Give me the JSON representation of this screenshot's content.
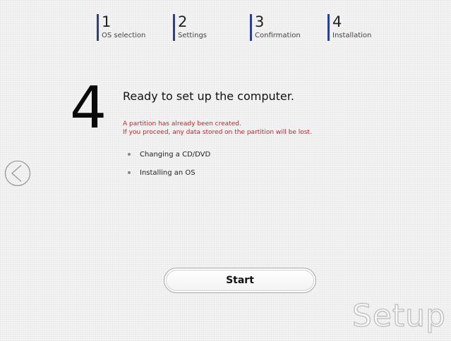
{
  "steps": [
    {
      "number": "1",
      "label": "OS selection"
    },
    {
      "number": "2",
      "label": "Settings"
    },
    {
      "number": "3",
      "label": "Confirmation"
    },
    {
      "number": "4",
      "label": "Installation"
    }
  ],
  "current_step": "4",
  "headline": "Ready to set up the computer.",
  "warning": {
    "line1": "A partition has already been created.",
    "line2": "If you proceed, any data stored on the partition will be lost."
  },
  "bullets": [
    "Changing a CD/DVD",
    "Installing an OS"
  ],
  "buttons": {
    "start": "Start",
    "back_icon": "back-arrow-icon"
  },
  "watermark": "Setup",
  "colors": {
    "step_accent": "#2a3f8f",
    "warning": "#e3171b",
    "background": "#f4f4f4"
  }
}
